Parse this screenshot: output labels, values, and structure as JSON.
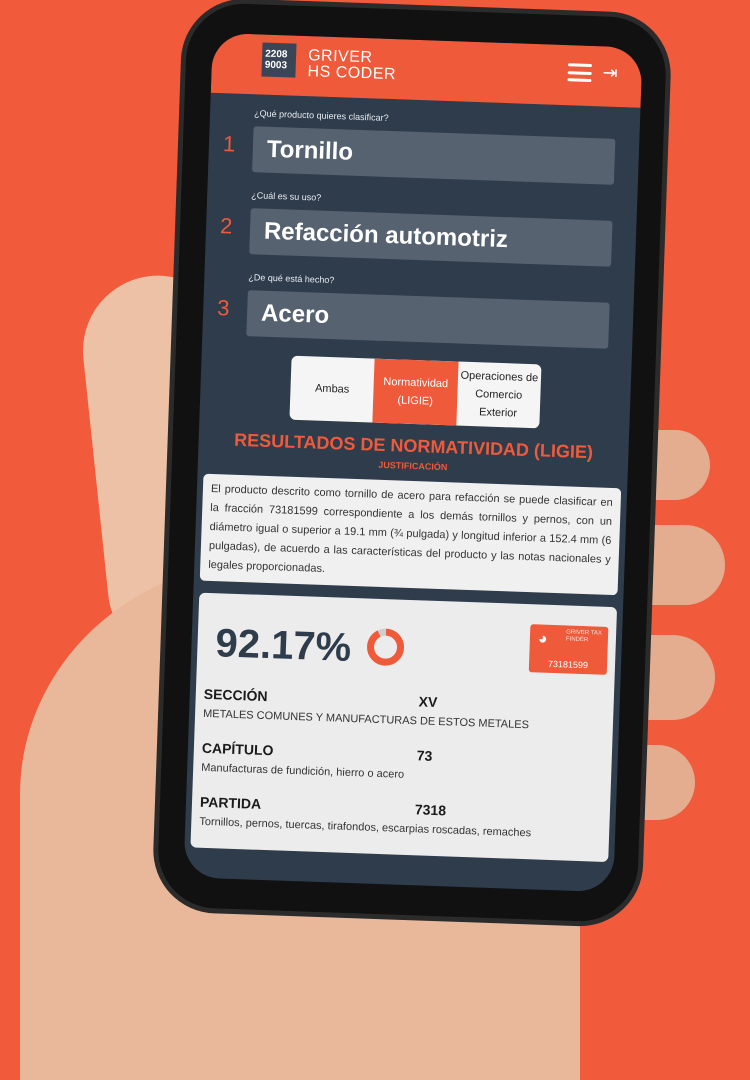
{
  "app": {
    "logo_line1": "2208",
    "logo_line2": "9003",
    "brand_line1": "GRIVER",
    "brand_line2": "HS CODER"
  },
  "questions": [
    {
      "num": "1",
      "label": "¿Qué producto quieres clasificar?",
      "value": "Tornillo"
    },
    {
      "num": "2",
      "label": "¿Cuál es su uso?",
      "value": "Refacción automotriz"
    },
    {
      "num": "3",
      "label": "¿De qué está hecho?",
      "value": "Acero"
    }
  ],
  "toggle": {
    "opt1": "Ambas",
    "opt2": "Normatividad (LIGIE)",
    "opt3": "Operaciones de Comercio Exterior"
  },
  "results": {
    "title": "RESULTADOS DE NORMATIVIDAD (LIGIE)",
    "justification_title": "JUSTIFICACIÓN",
    "justification": "El producto descrito como tornillo de acero para refacción se puede clasificar en la fracción 73181599 correspondiente a los demás tornillos y pernos, con un diámetro igual o superior a 19.1 mm (¾ pulgada) y longitud inferior a 152.4 mm (6 pulgadas), de acuerdo a las características del producto y las notas nacionales y legales proporcionadas."
  },
  "card": {
    "percent": "92.17%",
    "confidence": 92.17,
    "tax_text": "GRIVER TAX FINDER",
    "tax_code": "73181599",
    "sections": [
      {
        "key": "SECCIÓN",
        "value": "XV",
        "desc": "METALES COMUNES Y MANUFACTURAS DE ESTOS METALES"
      },
      {
        "key": "CAPÍTULO",
        "value": "73",
        "desc": "Manufacturas de fundición, hierro o acero"
      },
      {
        "key": "PARTIDA",
        "value": "7318",
        "desc": "Tornillos, pernos, tuercas, tirafondos, escarpias roscadas, remaches"
      }
    ]
  },
  "colors": {
    "accent": "#ef5a3a",
    "dark": "#2f3c4b"
  }
}
